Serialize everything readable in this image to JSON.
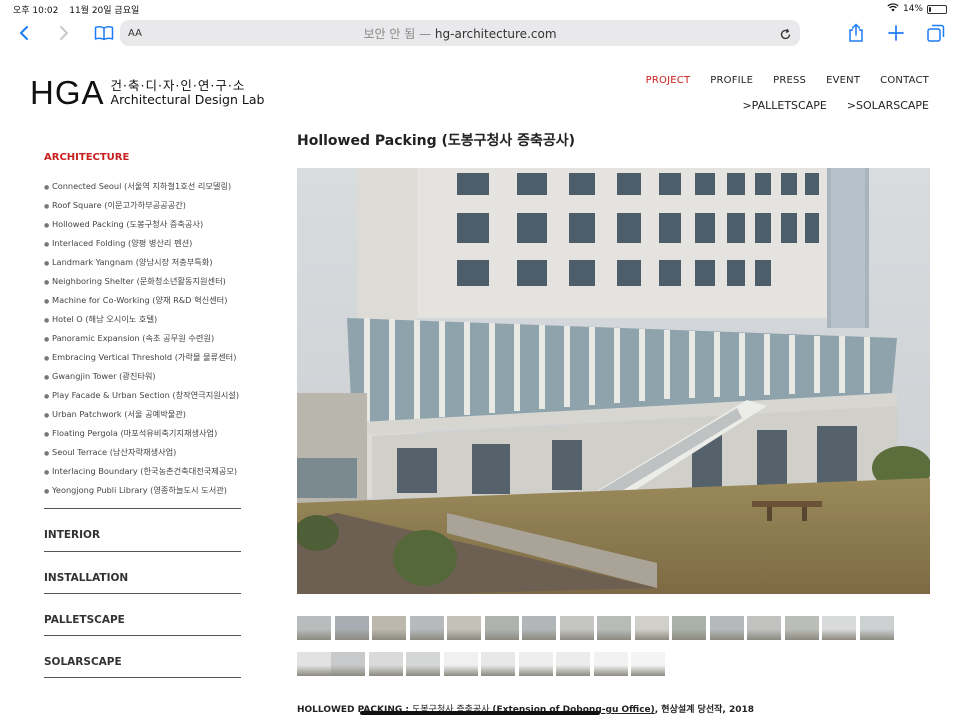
{
  "status": {
    "time": "오후 10:02",
    "date": "11월 20일 금요일",
    "battery": "14%",
    "battery_level": 0.14
  },
  "browser": {
    "aa_label": "AA",
    "security": "보안 안 됨",
    "sep": " — ",
    "domain": "hg-architecture.com"
  },
  "logo": {
    "mark": "HGA",
    "korean": "건·축·디·자·인·연·구·소",
    "english": "Architectural Design Lab"
  },
  "nav": {
    "items": [
      {
        "label": "PROJECT",
        "active": true
      },
      {
        "label": "PROFILE",
        "active": false
      },
      {
        "label": "PRESS",
        "active": false
      },
      {
        "label": "EVENT",
        "active": false
      },
      {
        "label": "CONTACT",
        "active": false
      }
    ],
    "sub": [
      ">PALLETSCAPE",
      ">SOLARSCAPE"
    ]
  },
  "sidebar": {
    "heading": "ARCHITECTURE",
    "projects": [
      "Connected Seoul (서울역 지하철1호선 리모델링)",
      "Roof Square (이문고가하부공공공간)",
      "Hollowed Packing (도봉구청사 증축공사)",
      "Interlaced Folding (양평 병산리 펜션)",
      "Landmark Yangnam (양남시장 저층부특화)",
      "Neighboring Shelter (문화청소년활동지원센터)",
      "Machine for Co-Working (양재 R&D 혁신센터)",
      "Hotel O (해남 오시이노 호텔)",
      "Panoramic Expansion (속초 공무원 수련원)",
      "Embracing Vertical Threshold (가락몰 물류센터)",
      "Gwangjin Tower (광진타워)",
      "Play Facade & Urban Section (창작연극지원시설)",
      "Urban Patchwork (서울 공예박물관)",
      "Floating Pergola (마포석유비축기지재생사업)",
      "Seoul Terrace (남산자락재생사업)",
      "Interlacing Boundary (한국농촌건축대전국제공모)",
      "Yeongjong Publi Library (영종하늘도시 도서관)"
    ],
    "categories": [
      "INTERIOR",
      "INSTALLATION",
      "PALLETSCAPE",
      "SOLARSCAPE"
    ]
  },
  "main": {
    "title": "Hollowed Packing (도봉구청사 증축공사)",
    "caption_title": "HOLLOWED PACKING",
    "caption_sep": " : ",
    "caption_kr": "도봉구청사 증축공사 ",
    "caption_en": "(Extension of Dobong-gu Office)",
    "caption_rest": ", 현상설계 당선작, 2018",
    "thumb_count": 26
  },
  "colors": {
    "accent": "#c8201e",
    "safari_blue": "#1b7cf5"
  }
}
